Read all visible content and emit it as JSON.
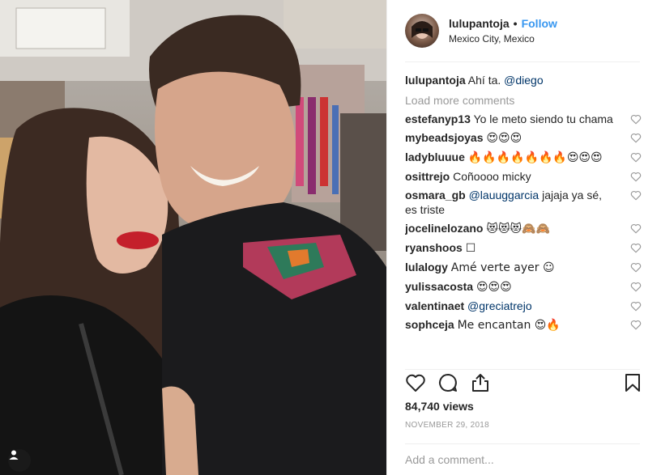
{
  "post": {
    "username": "lulupantoja",
    "separator": "•",
    "follow_label": "Follow",
    "location": "Mexico City, Mexico",
    "caption": {
      "username": "lulupantoja",
      "text": "Ahí ta.",
      "mention": "@diego"
    },
    "load_more_label": "Load more comments",
    "comments": [
      {
        "username": "estefanyp13",
        "text": "Yo le meto siendo tu chama"
      },
      {
        "username": "mybeadsjoyas",
        "text": "😍😍😍"
      },
      {
        "username": "ladybluuue",
        "text": "🔥🔥🔥🔥🔥🔥🔥😍😍😍"
      },
      {
        "username": "osittrejo",
        "text": "Coñoooo micky"
      },
      {
        "username": "osmara_gb",
        "mention": "@lauuggarcia",
        "text": "jajaja ya sé, es triste"
      },
      {
        "username": "jocelinelozano",
        "text": "😻😻😻🙈🙈"
      },
      {
        "username": "ryanshoos",
        "text": "☐"
      },
      {
        "username": "lulalogy",
        "text": "Amé verte ayer ☺"
      },
      {
        "username": "yulissacosta",
        "text": "😍😍😍"
      },
      {
        "username": "valentinaet",
        "mention": "@greciatrejo",
        "text": ""
      },
      {
        "username": "sophceja",
        "text": "Me encantan 😍🔥"
      }
    ],
    "views": "84,740 views",
    "date": "NOVEMBER 29, 2018",
    "add_comment_placeholder": "Add a comment..."
  },
  "icons": {
    "like": "heart-outline-icon",
    "comment": "comment-bubble-icon",
    "share": "share-icon",
    "save": "bookmark-icon",
    "comment_like": "small-heart-icon",
    "user_tag": "person-icon"
  },
  "colors": {
    "link": "#3897f0",
    "mention": "#003569",
    "muted": "#999999",
    "text": "#262626"
  }
}
